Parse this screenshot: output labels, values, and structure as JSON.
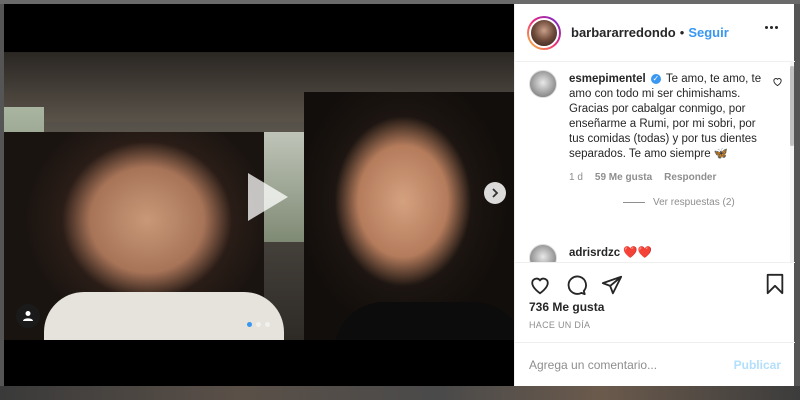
{
  "post": {
    "username": "barbararredondo",
    "separator": "•",
    "follow_label": "Seguir",
    "carousel": {
      "slide_count": 3,
      "active_index": 0
    }
  },
  "comments": [
    {
      "username": "esmepimentel",
      "verified": true,
      "text": "Te amo, te amo, te amo con todo mi ser chimishams. Gracias por cabalgar conmigo, por enseñarme a Rumi, por mi sobri, por tus comidas (todas) y por tus dientes separados. Te amo siempre 🦋",
      "age": "1 d",
      "likes": "59 Me gusta",
      "reply_label": "Responder",
      "view_replies": "Ver respuestas (2)"
    },
    {
      "username": "adrisrdzc",
      "text": "❤️❤️"
    }
  ],
  "likes_label": "736 Me gusta",
  "timestamp": "HACE UN DÍA",
  "comment_input": {
    "placeholder": "Agrega un comentario...",
    "publish_label": "Publicar"
  },
  "icons": [
    "heart-icon",
    "comment-icon",
    "share-icon",
    "bookmark-icon",
    "play-icon",
    "chevron-right-icon",
    "user-tag-icon",
    "more-icon"
  ],
  "colors": {
    "accent": "#3897f0",
    "publish_disabled": "#b2dffc",
    "text": "#262626",
    "muted": "#8e8e8e"
  }
}
